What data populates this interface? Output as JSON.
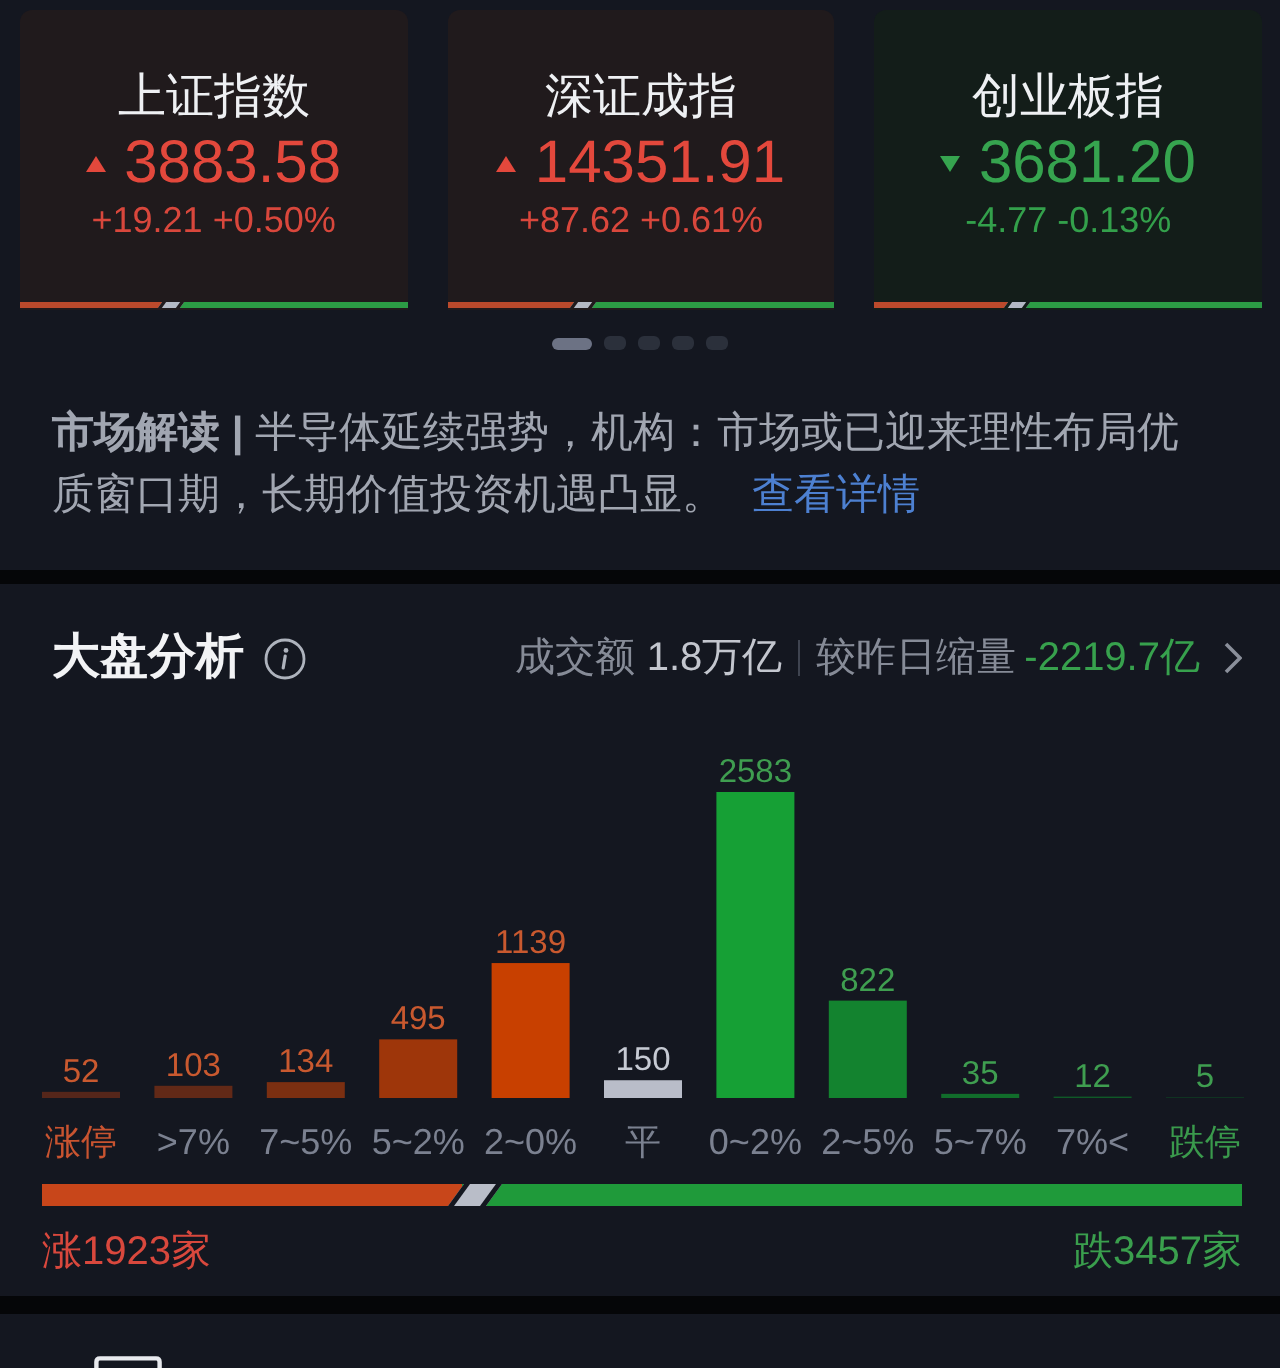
{
  "indices": [
    {
      "name": "上证指数",
      "kind": "up",
      "price": "3883.58",
      "change": "+19.21 +0.50%",
      "breadth": {
        "level": 0.37
      }
    },
    {
      "name": "深证成指",
      "kind": "up",
      "price": "14351.91",
      "change": "+87.62 +0.61%",
      "breadth": {
        "level": 0.33
      }
    },
    {
      "name": "创业板指",
      "kind": "down",
      "price": "3681.20",
      "change": "-4.77 -0.13%",
      "breadth": {
        "level": 0.35
      }
    }
  ],
  "pager": [
    {
      "selected": true
    },
    {
      "selected": false
    },
    {
      "selected": false
    },
    {
      "selected": false
    },
    {
      "selected": false
    }
  ],
  "commentary": {
    "text": "**市场解读 |** 半导体延续强势，机构：市场或已迎来理性布局优质窗口期，长期价值投资机遇凸显。",
    "link": "查看详情"
  },
  "analysis": {
    "title": "大盘分析",
    "turnover_label": "成交额",
    "turnover": "1.8万亿",
    "compare_label": "较昨日缩量",
    "compare_value": "-2219.7亿",
    "chart_data": {
      "type": "bar",
      "categories": [
        "涨停",
        ">7%",
        "7~5%",
        "5~2%",
        "2~0%",
        "平",
        "0~2%",
        "2~5%",
        "5~7%",
        "7%<",
        "跌停"
      ],
      "values": [
        52,
        103,
        134,
        495,
        1139,
        150,
        2583,
        822,
        35,
        12,
        5
      ],
      "data_labels": true
    },
    "breadth": {
      "level": 0.35,
      "up_count": "涨1923家",
      "down_count": "跌3457家"
    }
  }
}
